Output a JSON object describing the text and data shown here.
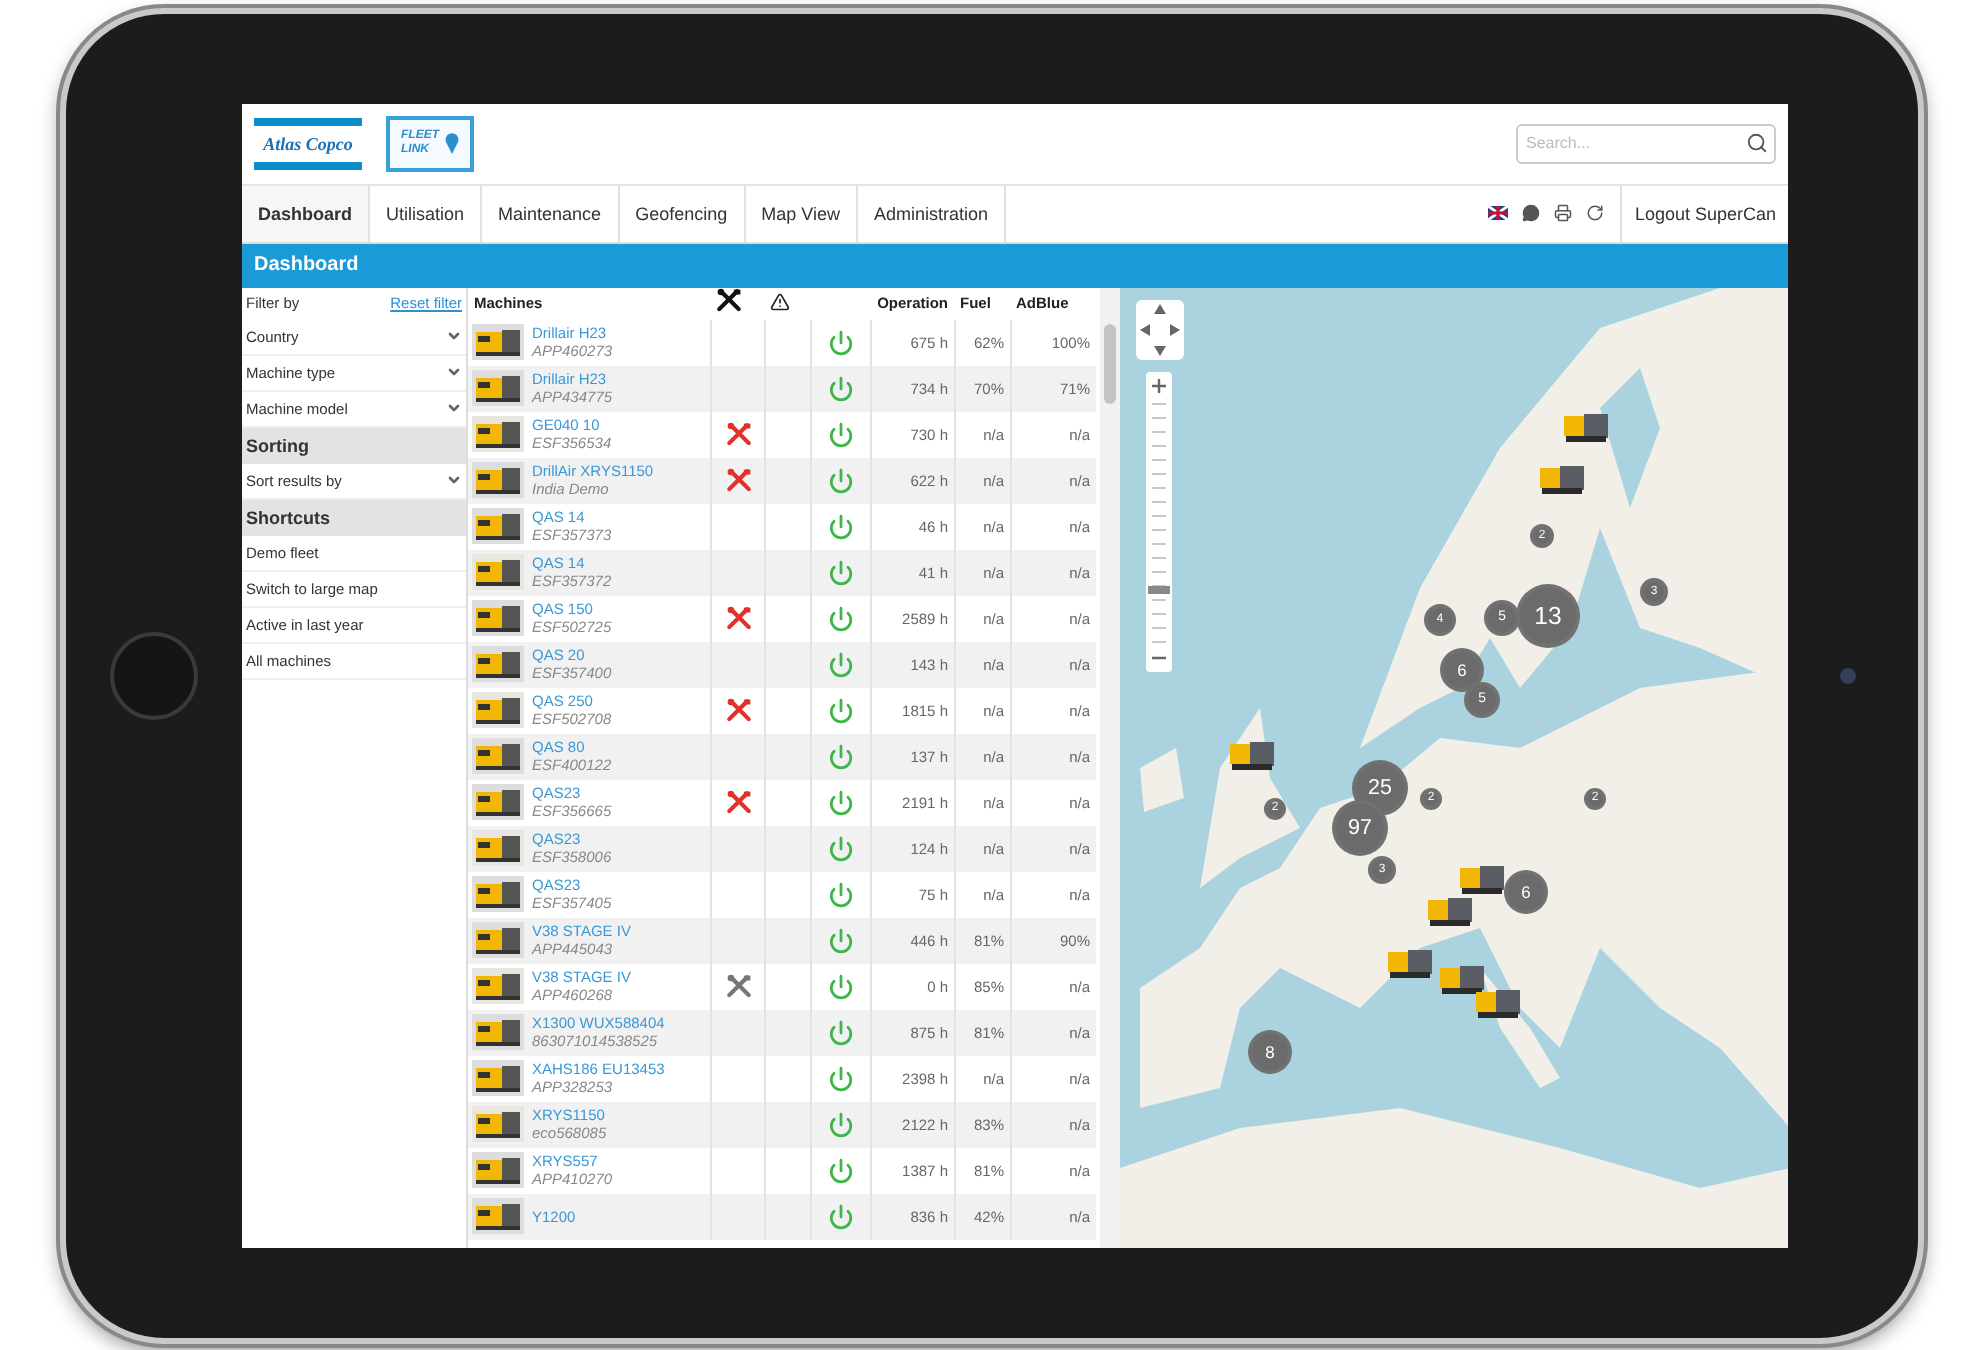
{
  "header": {
    "brand": "Atlas Copco",
    "product_logo": [
      "FLEET",
      "LINK"
    ],
    "search": {
      "placeholder": "Search..."
    }
  },
  "nav": {
    "items": [
      {
        "label": "Dashboard",
        "selected": true
      },
      {
        "label": "Utilisation",
        "selected": false
      },
      {
        "label": "Maintenance",
        "selected": false
      },
      {
        "label": "Geofencing",
        "selected": false
      },
      {
        "label": "Map View",
        "selected": false
      },
      {
        "label": "Administration",
        "selected": false
      }
    ],
    "logout": "Logout SuperCan"
  },
  "page_title": "Dashboard",
  "filters": {
    "title": "Filter by",
    "reset": "Reset filter",
    "selects": [
      "Country",
      "Machine type",
      "Machine model"
    ],
    "sorting_title": "Sorting",
    "sort_select": "Sort results by",
    "shortcuts_title": "Shortcuts",
    "shortcuts": [
      "Demo fleet",
      "Switch to large map",
      "Active in last year",
      "All machines"
    ]
  },
  "table": {
    "columns": [
      "Machines",
      "Operation",
      "Fuel",
      "AdBlue"
    ],
    "rows": [
      {
        "name": "Drillair H23",
        "serial": "APP460273",
        "alert": false,
        "maintenance_due": false,
        "operation": "675 h",
        "fuel": "62%",
        "adblue": "100%"
      },
      {
        "name": "Drillair H23",
        "serial": "APP434775",
        "alert": false,
        "maintenance_due": false,
        "operation": "734 h",
        "fuel": "70%",
        "adblue": "71%"
      },
      {
        "name": "GE040 10",
        "serial": "ESF356534",
        "alert": true,
        "maintenance_due": false,
        "operation": "730 h",
        "fuel": "n/a",
        "adblue": "n/a"
      },
      {
        "name": "DrillAir XRYS1150",
        "serial": "India Demo",
        "alert": true,
        "maintenance_due": false,
        "operation": "622 h",
        "fuel": "n/a",
        "adblue": "n/a"
      },
      {
        "name": "QAS 14",
        "serial": "ESF357373",
        "alert": false,
        "maintenance_due": false,
        "operation": "46 h",
        "fuel": "n/a",
        "adblue": "n/a"
      },
      {
        "name": "QAS 14",
        "serial": "ESF357372",
        "alert": false,
        "maintenance_due": false,
        "operation": "41 h",
        "fuel": "n/a",
        "adblue": "n/a"
      },
      {
        "name": "QAS 150",
        "serial": "ESF502725",
        "alert": true,
        "maintenance_due": false,
        "operation": "2589 h",
        "fuel": "n/a",
        "adblue": "n/a"
      },
      {
        "name": "QAS 20",
        "serial": "ESF357400",
        "alert": false,
        "maintenance_due": false,
        "operation": "143 h",
        "fuel": "n/a",
        "adblue": "n/a"
      },
      {
        "name": "QAS 250",
        "serial": "ESF502708",
        "alert": true,
        "maintenance_due": false,
        "operation": "1815 h",
        "fuel": "n/a",
        "adblue": "n/a"
      },
      {
        "name": "QAS 80",
        "serial": "ESF400122",
        "alert": false,
        "maintenance_due": false,
        "operation": "137 h",
        "fuel": "n/a",
        "adblue": "n/a"
      },
      {
        "name": "QAS23",
        "serial": "ESF356665",
        "alert": true,
        "maintenance_due": false,
        "operation": "2191 h",
        "fuel": "n/a",
        "adblue": "n/a"
      },
      {
        "name": "QAS23",
        "serial": "ESF358006",
        "alert": false,
        "maintenance_due": false,
        "operation": "124 h",
        "fuel": "n/a",
        "adblue": "n/a"
      },
      {
        "name": "QAS23",
        "serial": "ESF357405",
        "alert": false,
        "maintenance_due": false,
        "operation": "75 h",
        "fuel": "n/a",
        "adblue": "n/a"
      },
      {
        "name": "V38 STAGE IV",
        "serial": "APP445043",
        "alert": false,
        "maintenance_due": false,
        "operation": "446 h",
        "fuel": "81%",
        "adblue": "90%"
      },
      {
        "name": "V38 STAGE IV",
        "serial": "APP460268",
        "alert": false,
        "maintenance_due": true,
        "operation": "0 h",
        "fuel": "85%",
        "adblue": "n/a"
      },
      {
        "name": "X1300 WUX588404",
        "serial": "863071014538525",
        "alert": false,
        "maintenance_due": false,
        "operation": "875 h",
        "fuel": "81%",
        "adblue": "n/a"
      },
      {
        "name": "XAHS186 EU13453",
        "serial": "APP328253",
        "alert": false,
        "maintenance_due": false,
        "operation": "2398 h",
        "fuel": "n/a",
        "adblue": "n/a"
      },
      {
        "name": "XRYS1150",
        "serial": "eco568085",
        "alert": false,
        "maintenance_due": false,
        "operation": "2122 h",
        "fuel": "83%",
        "adblue": "n/a"
      },
      {
        "name": "XRYS557",
        "serial": "APP410270",
        "alert": false,
        "maintenance_due": false,
        "operation": "1387 h",
        "fuel": "81%",
        "adblue": "n/a"
      },
      {
        "name": "Y1200",
        "alert": false,
        "maintenance_due": false,
        "operation": "836 h",
        "fuel": "42%",
        "adblue": "n/a"
      }
    ]
  },
  "map": {
    "kind": "picture",
    "zoom": {
      "level": 0.25
    },
    "clusters": [
      "2",
      "4",
      "5",
      "13",
      "3",
      "6",
      "5",
      "25",
      "97",
      "2",
      "2",
      "2",
      "3",
      "6",
      "8"
    ]
  }
}
